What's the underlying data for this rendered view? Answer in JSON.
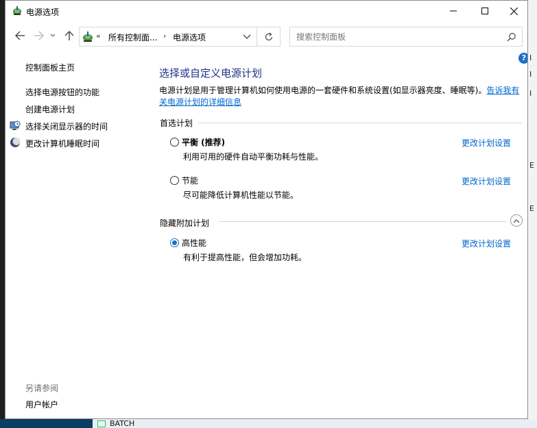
{
  "window": {
    "title": "电源选项"
  },
  "navigation": {
    "address_root": "«",
    "address_segments": [
      "所有控制面...",
      "电源选项"
    ],
    "address_separator": "›",
    "search_placeholder": "搜索控制面板",
    "help_label": "?"
  },
  "sidebar": {
    "home_link": "控制面板主页",
    "links": [
      {
        "label": "选择电源按钮的功能",
        "icon": null
      },
      {
        "label": "创建电源计划",
        "icon": null
      },
      {
        "label": "选择关闭显示器的时间",
        "icon": "monitor-clock-icon"
      },
      {
        "label": "更改计算机睡眠时间",
        "icon": "moon-icon"
      }
    ],
    "see_also_label": "另请参阅",
    "see_also_links": [
      "用户帐户"
    ]
  },
  "main": {
    "title": "选择或自定义电源计划",
    "description": "电源计划是用于管理计算机如何使用电源的一套硬件和系统设置(如显示器亮度、睡眠等)。",
    "description_link": "告诉我有关电源计划的详细信息",
    "preferred_header": "首选计划",
    "hidden_header": "隐藏附加计划",
    "change_link": "更改计划设置",
    "plans": [
      {
        "name": "平衡 (推荐)",
        "desc": "利用可用的硬件自动平衡功耗与性能。",
        "selected": false,
        "bold": true
      },
      {
        "name": "节能",
        "desc": "尽可能降低计算机性能以节能。",
        "selected": false,
        "bold": false
      },
      {
        "name": "高性能",
        "desc": "有利于提高性能，但会增加功耗。",
        "selected": true,
        "bold": false
      }
    ]
  },
  "desktop": {
    "right_fragments": [
      "I",
      "I",
      "I",
      "E",
      "E"
    ],
    "taskbar_item": "BATCH"
  },
  "colors": {
    "title_blue": "#1e3287",
    "link_blue": "#0066cc",
    "radio_blue": "#1e6fc9"
  }
}
